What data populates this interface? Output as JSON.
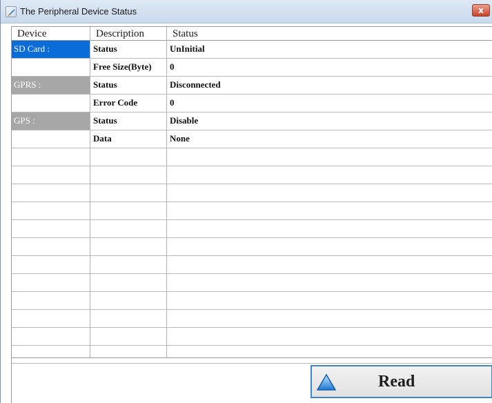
{
  "window": {
    "title": "The Peripheral Device Status",
    "close_label": "x"
  },
  "grid": {
    "headers": [
      "Device",
      "Description",
      "Status"
    ],
    "rows": [
      {
        "device": "SD Card :",
        "description": "Status",
        "status": "UnInitial",
        "style": "selected"
      },
      {
        "device": "",
        "description": "Free Size(Byte)",
        "status": "0",
        "style": ""
      },
      {
        "device": "GPRS :",
        "description": "Status",
        "status": "Disconnected",
        "style": "group"
      },
      {
        "device": "",
        "description": "Error Code",
        "status": "0",
        "style": ""
      },
      {
        "device": "GPS :",
        "description": "Status",
        "status": "Disable",
        "style": "group"
      },
      {
        "device": "",
        "description": "Data",
        "status": "None",
        "style": ""
      },
      {
        "device": "",
        "description": "",
        "status": "",
        "style": ""
      },
      {
        "device": "",
        "description": "",
        "status": "",
        "style": ""
      },
      {
        "device": "",
        "description": "",
        "status": "",
        "style": ""
      },
      {
        "device": "",
        "description": "",
        "status": "",
        "style": ""
      },
      {
        "device": "",
        "description": "",
        "status": "",
        "style": ""
      },
      {
        "device": "",
        "description": "",
        "status": "",
        "style": ""
      },
      {
        "device": "",
        "description": "",
        "status": "",
        "style": ""
      },
      {
        "device": "",
        "description": "",
        "status": "",
        "style": ""
      },
      {
        "device": "",
        "description": "",
        "status": "",
        "style": ""
      },
      {
        "device": "",
        "description": "",
        "status": "",
        "style": ""
      },
      {
        "device": "",
        "description": "",
        "status": "",
        "style": ""
      },
      {
        "device": "",
        "description": "",
        "status": "",
        "style": ""
      }
    ]
  },
  "actions": {
    "read_label": "Read",
    "read_icon": "triangle-up-icon"
  },
  "colors": {
    "selected_row": "#0a6cd6",
    "group_row": "#a7a7a7",
    "button_border": "#3b86cc"
  }
}
